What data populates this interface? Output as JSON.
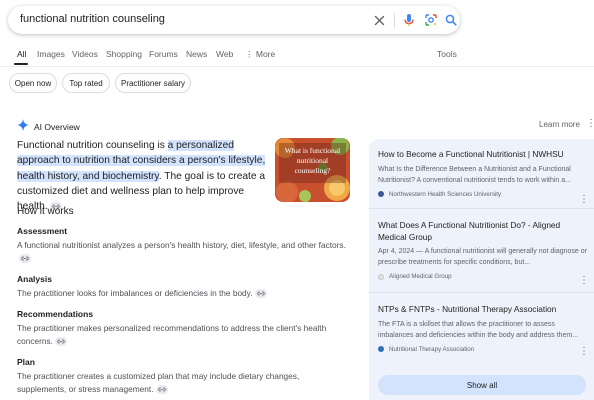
{
  "search": {
    "query": "functional nutrition counseling"
  },
  "nav": {
    "tabs": [
      "All",
      "Images",
      "Videos",
      "Shopping",
      "Forums",
      "News",
      "Web",
      "More"
    ],
    "tools": "Tools"
  },
  "chips": [
    "Open now",
    "Top rated",
    "Practitioner salary"
  ],
  "ai_overview": {
    "title": "AI Overview",
    "learn_more": "Learn more",
    "lead_start": "Functional nutrition counseling is ",
    "lead_highlight": "a personalized approach to nutrition that considers a person's lifestyle, health history, and biochemistry",
    "lead_end": ". The goal is to create a customized diet and wellness plan to help improve health.",
    "thumb_caption": "What is functional nutritional counseling?",
    "how_heading": "How it works",
    "steps": [
      {
        "title": "Assessment",
        "body": "A functional nutritionist analyzes a person's health history, diet, lifestyle, and other factors."
      },
      {
        "title": "Analysis",
        "body": "The practitioner looks for imbalances or deficiencies in the body."
      },
      {
        "title": "Recommendations",
        "body": "The practitioner makes personalized recommendations to address the client's health concerns."
      },
      {
        "title": "Plan",
        "body": "The practitioner creates a customized plan that may include dietary changes, supplements, or stress management."
      }
    ]
  },
  "sources": [
    {
      "title": "How to Become a Functional Nutritionist | NWHSU",
      "snippet": "What Is the Difference Between a Nutritionist and a Functional Nutritionist? A conventional nutritionist tends to work within a...",
      "source": "Northwestern Health Sciences University",
      "color": "#3c5a9a"
    },
    {
      "title": "What Does A Functional Nutritionist Do? - Aligned Medical Group",
      "snippet": "Apr 4, 2024 — A functional nutritionist will generally not diagnose or prescribe treatments for specific conditions, but...",
      "source": "Aligned Medical Group",
      "color": "#e0e0e0"
    },
    {
      "title": "NTPs & FNTPs - Nutritional Therapy Association",
      "snippet": "The FTA is a skillset that allows the practitioner to assess imbalances and deficiencies within the body and address them...",
      "source": "Nutritional Therapy Association",
      "color": "#2e6fba"
    }
  ],
  "show_all": "Show all",
  "colors": {
    "highlight": "#d3e3fd",
    "panel": "#eef2fb",
    "accent_blue": "#1a73e8"
  }
}
